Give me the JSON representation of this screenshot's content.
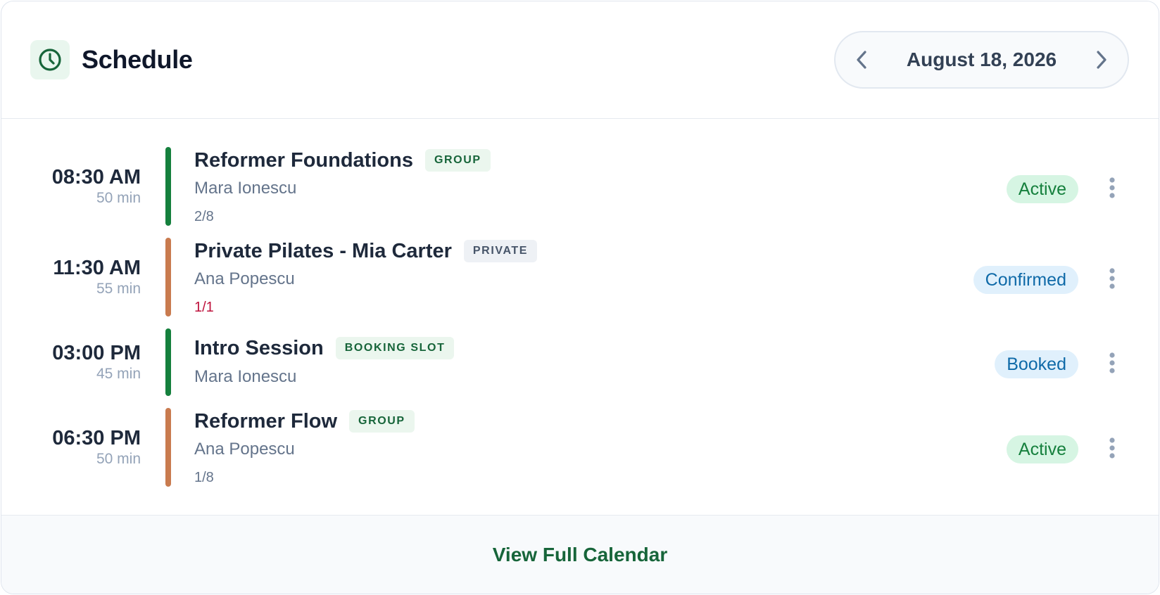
{
  "header": {
    "title": "Schedule",
    "icon": "clock-icon",
    "date": "August 18, 2026",
    "prev_icon": "chevron-left-icon",
    "next_icon": "chevron-right-icon"
  },
  "colors": {
    "brand_green": "#17653a",
    "bar_green": "#15803d",
    "bar_orange": "#c97b4f",
    "full_capacity": "#be123c"
  },
  "events": [
    {
      "time": "08:30 AM",
      "duration": "50 min",
      "name": "Reformer Foundations",
      "type": "GROUP",
      "instructor": "Mara Ionescu",
      "capacity": "2/8",
      "status": "Active",
      "bar_color": "green"
    },
    {
      "time": "11:30 AM",
      "duration": "55 min",
      "name": "Private Pilates - Mia Carter",
      "type": "PRIVATE",
      "instructor": "Ana Popescu",
      "capacity": "1/1",
      "status": "Confirmed",
      "bar_color": "orange"
    },
    {
      "time": "03:00 PM",
      "duration": "45 min",
      "name": "Intro Session",
      "type": "BOOKING SLOT",
      "instructor": "Mara Ionescu",
      "status": "Booked",
      "bar_color": "green"
    },
    {
      "time": "06:30 PM",
      "duration": "50 min",
      "name": "Reformer Flow",
      "type": "GROUP",
      "instructor": "Ana Popescu",
      "capacity": "1/8",
      "status": "Active",
      "bar_color": "orange"
    }
  ],
  "footer": {
    "link_label": "View Full Calendar"
  }
}
